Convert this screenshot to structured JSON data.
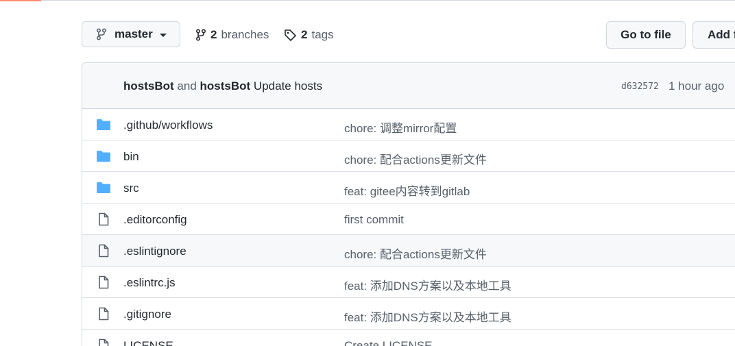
{
  "toolbar": {
    "branch_name": "master",
    "branches_count": "2",
    "branches_label": "branches",
    "tags_count": "2",
    "tags_label": "tags",
    "goto_file_label": "Go to file",
    "add_file_label": "Add f"
  },
  "commit": {
    "author1": "hostsBot",
    "and_text": "and",
    "author2": "hostsBot",
    "message": "Update hosts",
    "sha": "d632572",
    "time": "1 hour ago"
  },
  "files": [
    {
      "type": "folder",
      "name": ".github/workflows",
      "message": "chore: 调整mirror配置",
      "highlight": false
    },
    {
      "type": "folder",
      "name": "bin",
      "message": "chore: 配合actions更新文件",
      "highlight": false
    },
    {
      "type": "folder",
      "name": "src",
      "message": "feat: gitee内容转到gitlab",
      "highlight": false
    },
    {
      "type": "file",
      "name": ".editorconfig",
      "message": "first commit",
      "highlight": false
    },
    {
      "type": "file",
      "name": ".eslintignore",
      "message": "chore: 配合actions更新文件",
      "highlight": true
    },
    {
      "type": "file",
      "name": ".eslintrc.js",
      "message": "feat: 添加DNS方案以及本地工具",
      "highlight": false
    },
    {
      "type": "file",
      "name": ".gitignore",
      "message": "feat: 添加DNS方案以及本地工具",
      "highlight": false
    },
    {
      "type": "file",
      "name": "LICENSE",
      "message": "Create LICENSE",
      "highlight": false
    }
  ],
  "colors": {
    "folder_icon": "#54aeff",
    "file_icon": "#57606a",
    "accent": "#fd8c73"
  },
  "icons": {
    "branch": "git-branch-icon",
    "tag": "tag-icon",
    "folder": "folder-icon",
    "file": "file-icon",
    "caret": "chevron-down-icon"
  }
}
